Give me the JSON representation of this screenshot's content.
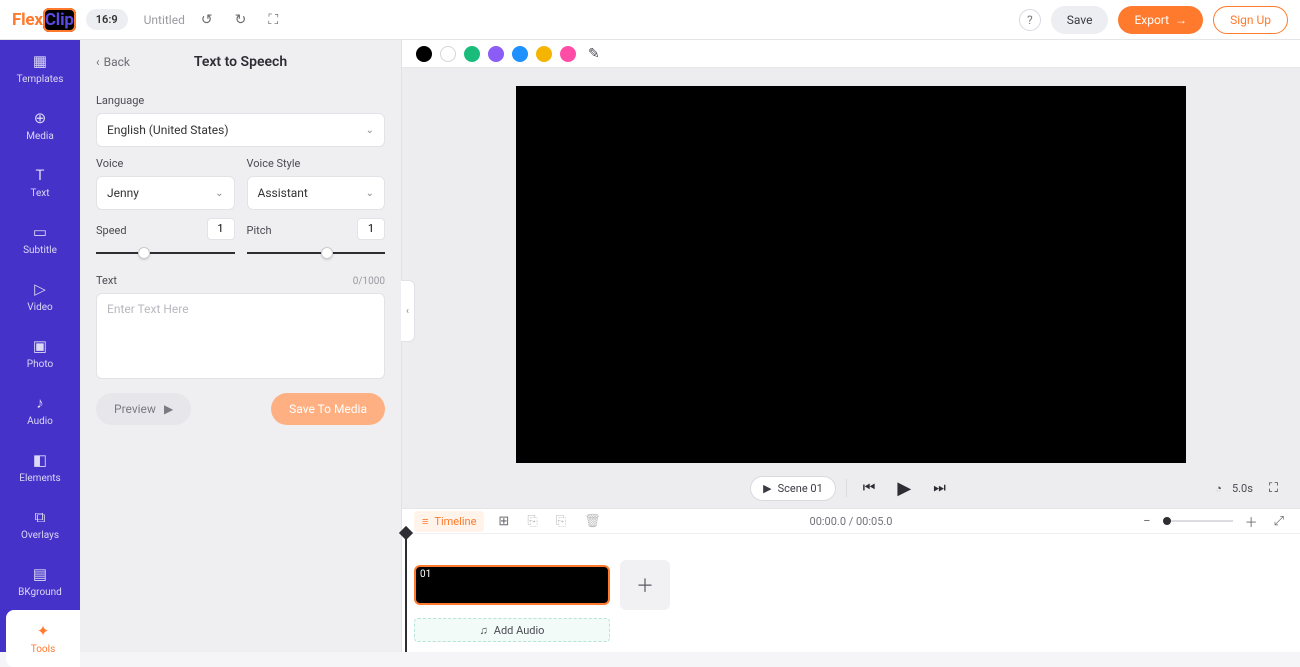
{
  "brand": {
    "part1": "Flex",
    "part2": "Clip"
  },
  "topbar": {
    "aspect": "16:9",
    "title": "Untitled",
    "save": "Save",
    "export": "Export",
    "signup": "Sign Up"
  },
  "rail": {
    "items": [
      {
        "icon": "▦",
        "label": "Templates"
      },
      {
        "icon": "⊕",
        "label": "Media"
      },
      {
        "icon": "T",
        "label": "Text"
      },
      {
        "icon": "▭",
        "label": "Subtitle"
      },
      {
        "icon": "▷",
        "label": "Video"
      },
      {
        "icon": "▣",
        "label": "Photo"
      },
      {
        "icon": "♪",
        "label": "Audio"
      },
      {
        "icon": "◧",
        "label": "Elements"
      },
      {
        "icon": "⧉",
        "label": "Overlays"
      },
      {
        "icon": "▤",
        "label": "BKground"
      },
      {
        "icon": "✦",
        "label": "Tools"
      }
    ],
    "activeIndex": 10
  },
  "panel": {
    "back": "Back",
    "title": "Text to Speech",
    "language": {
      "label": "Language",
      "value": "English (United States)"
    },
    "voice": {
      "label": "Voice",
      "value": "Jenny"
    },
    "voiceStyle": {
      "label": "Voice Style",
      "value": "Assistant"
    },
    "speed": {
      "label": "Speed",
      "value": "1"
    },
    "pitch": {
      "label": "Pitch",
      "value": "1"
    },
    "text": {
      "label": "Text",
      "counter": "0/1000",
      "placeholder": "Enter Text Here"
    },
    "preview": "Preview",
    "saveToMedia": "Save To Media"
  },
  "palette": {
    "colors": [
      "#000000",
      "#ffffff",
      "#1abc7b",
      "#8b5cf6",
      "#1e90ff",
      "#f5b400",
      "#ff4da6"
    ]
  },
  "player": {
    "scene": "Scene 01",
    "duration": "5.0s"
  },
  "timeline": {
    "chip": "Timeline",
    "timecode": "00:00.0 / 00:05.0",
    "clipNum": "01",
    "addAudio": "Add Audio"
  }
}
